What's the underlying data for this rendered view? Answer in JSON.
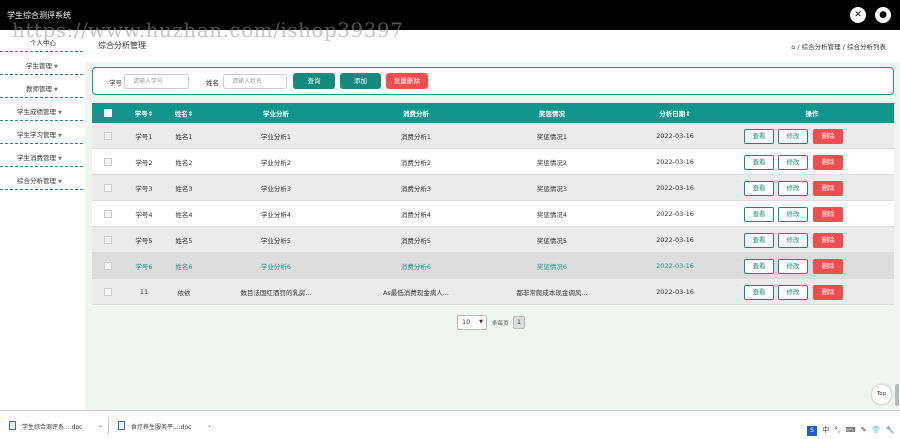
{
  "app": {
    "title": "学生综合测评系统"
  },
  "watermark": "https://www.huzhan.com/ishop39397",
  "sidebar": {
    "items": [
      {
        "label": "个人中心"
      },
      {
        "label": "学生管理"
      },
      {
        "label": "教师管理"
      },
      {
        "label": "学生成绩管理"
      },
      {
        "label": "学生学习管理"
      },
      {
        "label": "学生消费管理"
      },
      {
        "label": "综合分析管理"
      }
    ]
  },
  "page": {
    "title": "综合分析管理",
    "breadcrumb": "⌂ / 综合分析管理 / 综合分析列表"
  },
  "search": {
    "student_no_label": "学号",
    "student_no_placeholder": "请输入学号",
    "name_label": "姓名",
    "name_placeholder": "请输入姓名",
    "query_label": "查询",
    "add_label": "添加",
    "batch_delete_label": "批量删除"
  },
  "table": {
    "headers": [
      "学号⇕",
      "姓名⇕",
      "学业分析",
      "消费分析",
      "奖惩情况",
      "分析日期⇕",
      "操作"
    ],
    "rows": [
      {
        "student_no": "学号1",
        "name": "姓名1",
        "academic": "学业分析1",
        "consumption": "消费分析1",
        "reward": "奖惩情况1",
        "date": "2022-03-16"
      },
      {
        "student_no": "学号2",
        "name": "姓名2",
        "academic": "学业分析2",
        "consumption": "消费分析2",
        "reward": "奖惩情况2",
        "date": "2022-03-16"
      },
      {
        "student_no": "学号3",
        "name": "姓名3",
        "academic": "学业分析3",
        "consumption": "消费分析3",
        "reward": "奖惩情况3",
        "date": "2022-03-16"
      },
      {
        "student_no": "学号4",
        "name": "姓名4",
        "academic": "学业分析4",
        "consumption": "消费分析4",
        "reward": "奖惩情况4",
        "date": "2022-03-16"
      },
      {
        "student_no": "学号5",
        "name": "姓名5",
        "academic": "学业分析5",
        "consumption": "消费分析5",
        "reward": "奖惩情况5",
        "date": "2022-03-16"
      },
      {
        "student_no": "学号6",
        "name": "姓名6",
        "academic": "学业分析6",
        "consumption": "消费分析6",
        "reward": "奖惩情况6",
        "date": "2022-03-16"
      },
      {
        "student_no": "11",
        "name": "依依",
        "academic": "数目法国红酒罚的乳房...",
        "consumption": "As最低消费现金病人...",
        "reward": "都非常爬成本现金调风...",
        "date": "2022-03-16"
      }
    ],
    "actions": {
      "view": "查看",
      "edit": "修改",
      "delete": "删除"
    }
  },
  "pagination": {
    "page_size": "10",
    "per_page_label": "条每页",
    "current_page": "1"
  },
  "back_to_top": "Top",
  "downloads": [
    {
      "name": "学生综合测评系....doc"
    },
    {
      "name": "食疗养生服务平....doc"
    }
  ],
  "tray": [
    "中",
    "°,",
    "⌨",
    "✎",
    "👕",
    "🔧"
  ],
  "colors": {
    "primary": "#12958b",
    "danger": "#f04e4e",
    "topbar": "#000000"
  }
}
